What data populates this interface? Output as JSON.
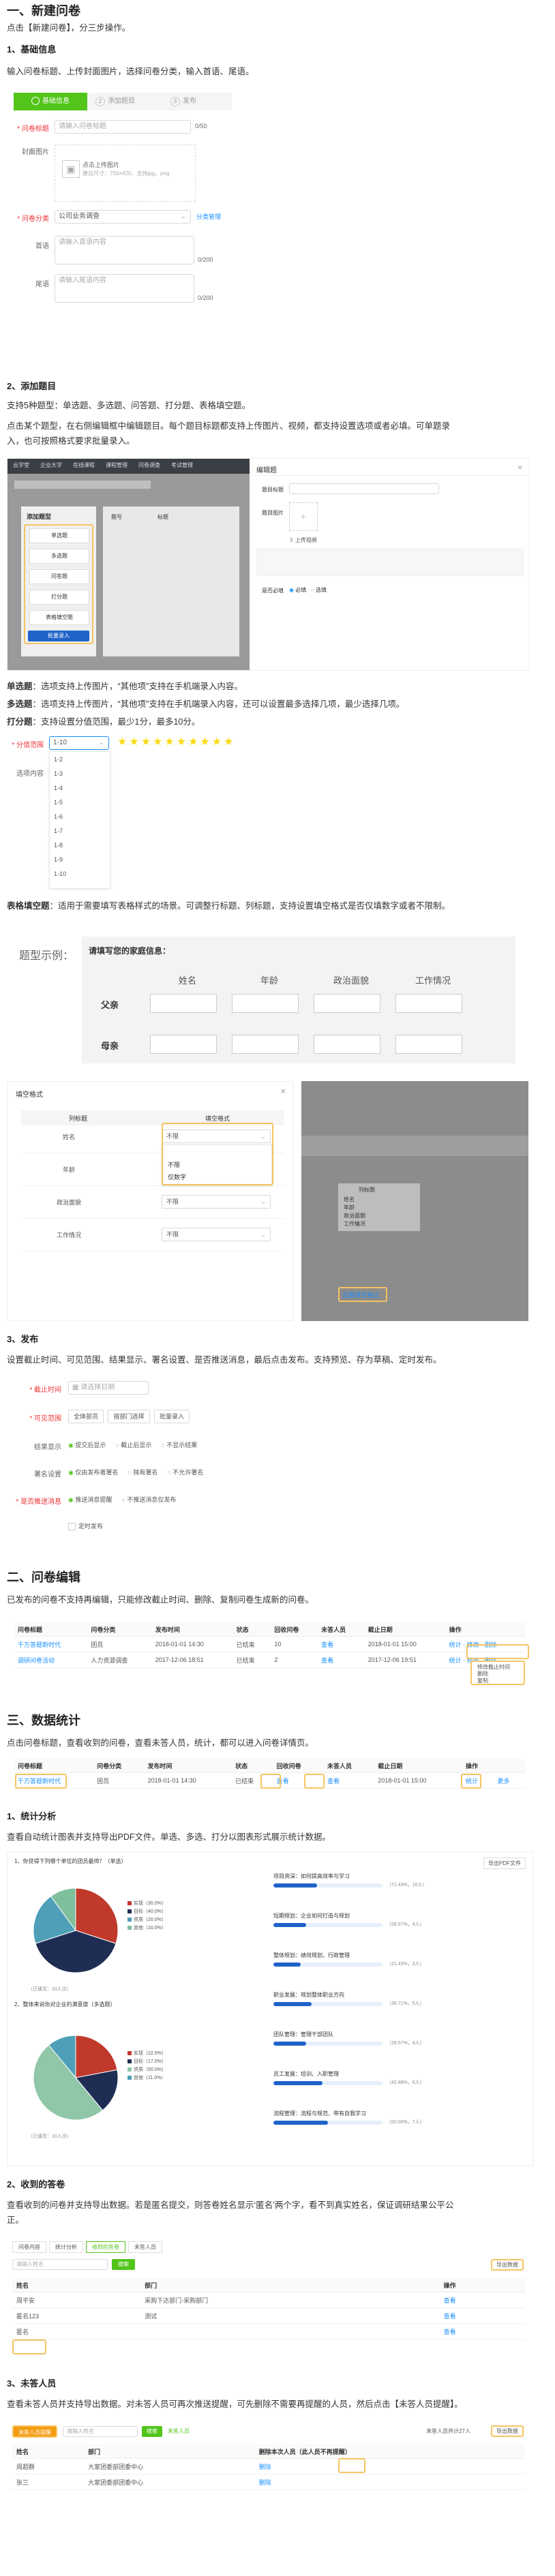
{
  "s1": {
    "title": "一、新建问卷",
    "intro": "点击【新建问卷】，分三步操作。",
    "sub1": "1、基础信息",
    "sub1_text": "输入问卷标题、上传封面图片，选择问卷分类，输入首语、尾语。",
    "steps": [
      "基础信息",
      "添加题目",
      "发布"
    ],
    "step_nums": [
      "2",
      "3"
    ],
    "form": {
      "title_label": "* 问卷标题",
      "title_ph": "请输入问卷标题",
      "title_count": "0/50",
      "cover_label": "封面图片",
      "cover_text": "点击上传图片",
      "cover_hint": "建议尺寸：750×420，支持jpg、png",
      "cat_label": "* 问卷分类",
      "cat_value": "公司业务调查",
      "cat_link": "分类管理",
      "head_label": "首语",
      "head_ph": "请输入首语内容",
      "head_count": "0/200",
      "tail_label": "尾语",
      "tail_ph": "请输入尾语内容",
      "tail_count": "0/200"
    },
    "sub2": "2、添加题目",
    "sub2_text1": "支持5种题型：单选题、多选题、问答题、打分题、表格填空题。",
    "sub2_text2": "点击某个题型，在右侧编辑框中编辑题目。每个题目标题都支持上传图片、视频，都支持设置选项或者必填。可单题录",
    "sub2_text3": "入，也可按照格式要求批量录入。",
    "editor": {
      "topbar": [
        "云学堂",
        "企业大学",
        "在线课程",
        "课程管理",
        "问卷调查",
        "考试管理"
      ],
      "types_title": "添加题型",
      "types": [
        "单选题",
        "多选题",
        "问答题",
        "打分题",
        "表格填空题"
      ],
      "batch": "批量录入",
      "cols": [
        "题号",
        "标题"
      ],
      "panel_title": "编辑题",
      "panel_q": "题目标题",
      "panel_img": "题目图片",
      "panel_video": "上传视频",
      "required_label": "是否必填",
      "required_opts": [
        "必填",
        "选填"
      ]
    },
    "single_bold": "单选题",
    "single_text": "：选项支持上传图片，“其他项”支持在手机端录入内容。",
    "multi_bold": "多选题",
    "multi_text": "：选项支持上传图片，“其他项”支持在手机端录入内容，还可以设置最多选择几项，最少选择几项。",
    "score_bold": "打分题",
    "score_text": "：支持设置分值范围，最少1分，最多10分。",
    "score": {
      "range_label": "* 分值范围",
      "range_value": "1-10",
      "stars": "★★★★★★★★★★",
      "option_label": "选项内容",
      "options": [
        "1-2",
        "1-3",
        "1-4",
        "1-5",
        "1-6",
        "1-7",
        "1-8",
        "1-9",
        "1-10"
      ]
    },
    "table_bold": "表格填空题",
    "table_text": "：适用于需要填写表格样式的场景。可调整行标题、列标题，支持设置填空格式是否仅填数字或者不限制。",
    "example": {
      "title": "题型示例：",
      "question": "请填写您的家庭信息：",
      "cols": [
        "姓名",
        "年龄",
        "政治面貌",
        "工作情况"
      ],
      "rows": [
        "父亲",
        "母亲"
      ]
    },
    "fill": {
      "title": "填空格式",
      "close": "×",
      "head": [
        "列标题",
        "填空格式"
      ],
      "rows": [
        "姓名",
        "年龄",
        "政治面貌",
        "工作情况"
      ],
      "values": [
        "不限",
        "不限",
        "不限",
        "不限"
      ],
      "options": [
        "不限",
        "仅数字"
      ],
      "right_list_title": "列标题",
      "right_list": [
        "姓名",
        "年龄",
        "政治面貌",
        "工作情况"
      ],
      "right_btn": "设置填空格式"
    },
    "sub3": "3、发布",
    "sub3_text": "设置截止时间、可见范围、结果显示、署名设置、是否推送消息，最后点击发布。支持预览、存为草稿、定时发布。",
    "publish": {
      "deadline_label": "* 截止时间",
      "deadline_ph": "请选择日期",
      "scope_label": "* 可见范围",
      "scope_btns": [
        "全体部员",
        "按部门选择",
        "批量录入"
      ],
      "result_label": "结果显示",
      "result_opts": [
        "提交后显示",
        "截止后显示",
        "不显示结果"
      ],
      "sign_label": "署名设置",
      "sign_opts": [
        "仅由发布者署名",
        "独有署名",
        "不允许署名"
      ],
      "push_label": "* 是否推送消息",
      "push_opts": [
        "推送消息提醒",
        "不推送消息仅发布"
      ],
      "timed": "定时发布"
    }
  },
  "s2": {
    "title": "二、问卷编辑",
    "text": "已发布的问卷不支持再编辑，只能修改截止时间、删除、复制问卷生成新的问卷。",
    "cols": [
      "问卷标题",
      "问卷分类",
      "发布时间",
      "状态",
      "回收问卷",
      "未答人员",
      "截止日期",
      "操作"
    ],
    "rows": [
      [
        "千万答题新时代",
        "团员",
        "2018-01-01 14:30",
        "已结束",
        "10",
        "查看",
        "2018-01-01 15:00",
        "统计 · 修改 · 删除"
      ],
      [
        "调研问卷活动",
        "人力资源调查",
        "2017-12-06 18:51",
        "已结束",
        "2",
        "查看",
        "2017-12-06 19:51",
        "统计 · 修改 · 删除"
      ]
    ],
    "menu": [
      "修改截止时间",
      "删除",
      "复制"
    ]
  },
  "s3": {
    "title": "三、数据统计",
    "text": "点击问卷标题，查看收到的问卷，查看未答人员，统计，都可以进入问卷详情页。",
    "cols": [
      "问卷标题",
      "问卷分类",
      "发布时间",
      "状态",
      "回收问卷",
      "未答人员",
      "截止日期",
      "操作"
    ],
    "row": [
      "千万答题新时代",
      "团员",
      "2018-01-01 14:30",
      "已结束",
      "查看",
      "查看",
      "2018-01-01 15:00",
      "统计",
      "更多"
    ],
    "sub1": "1、统计分析",
    "sub1_text": "查看自动统计图表并支持导出PDF文件。单选、多选、打分以图表形式展示统计数据。",
    "export": "导出PDF文件",
    "q1_title": "1、你觉得下列哪个单位的团员最帅？（单选）",
    "q2_title": "2、整体来说你对企业的满意度（多选题）",
    "pie1_legend": [
      "实现（30.0%）",
      "目标（40.0%）",
      "资质（20.0%）",
      "其他（10.0%）"
    ],
    "pie2_legend": [
      "实现（22.0%）",
      "目标（17.0%）",
      "资质（50.0%）",
      "其他（11.0%）"
    ],
    "pie_stats": "（已填写：10人次）",
    "bars": [
      {
        "label": "项目资深：如何提高效率与学习",
        "value": 0.4,
        "pct": "（71.43%，10人）"
      },
      {
        "label": "短期规划：企业如何打造与规划",
        "value": 0.3,
        "pct": "（28.57%，4人）"
      },
      {
        "label": "整体规划：绩效规划、行政管理",
        "value": 0.25,
        "pct": "（21.43%，3人）"
      },
      {
        "label": "职业发展：规划整体职业方向",
        "value": 0.35,
        "pct": "（35.71%，5人）"
      },
      {
        "label": "团队管理：管理干部团队",
        "value": 0.3,
        "pct": "（28.57%，4人）"
      },
      {
        "label": "员工发展：培训、入职管理",
        "value": 0.45,
        "pct": "（42.86%，6人）"
      },
      {
        "label": "流程管理：流程与规范、带有自我学习",
        "value": 0.5,
        "pct": "（50.00%，7人）"
      }
    ],
    "sub2": "2、收到的答卷",
    "sub2_text": "查看收到的问卷并支持导出数据。若是匿名提交，则答卷姓名显示‘匿名’两个字，看不到真实姓名，保证调研结果公平公",
    "sub2_text2": "正。",
    "ans_tabs": [
      "问卷内容",
      "统计分析",
      "收到的答卷",
      "未答人员"
    ],
    "ans_search_ph": "请输入姓名",
    "ans_search_btn": "搜索",
    "ans_export": "导出数据",
    "ans_cols": [
      "姓名",
      "部门",
      "操作"
    ],
    "ans_rows": [
      [
        "周平安",
        "采购下达部门-采购部门",
        "查看"
      ],
      [
        "匿名123",
        "测试",
        "查看"
      ],
      [
        "匿名",
        "",
        "查看"
      ]
    ],
    "sub3": "3、未答人员",
    "sub3_text": "查看未答人员并支持导出数据。对未答人员可再次推送提醒，可先删除不需要再提醒的人员，然后点击【未答人员提醒】。",
    "un_btn": "未答人员提醒",
    "un_search_ph": "请输入姓名",
    "un_tabs": [
      "搜索",
      "未答人员"
    ],
    "un_count": "未答人员共计27人",
    "un_export": "导出数据",
    "un_cols": [
      "姓名",
      "部门",
      "删除本次人员（此人员不再提醒）"
    ],
    "un_rows": [
      [
        "周超群",
        "大家团委部团委中心",
        "删除"
      ],
      [
        "张三",
        "大家团委部团委中心",
        "删除"
      ]
    ]
  }
}
